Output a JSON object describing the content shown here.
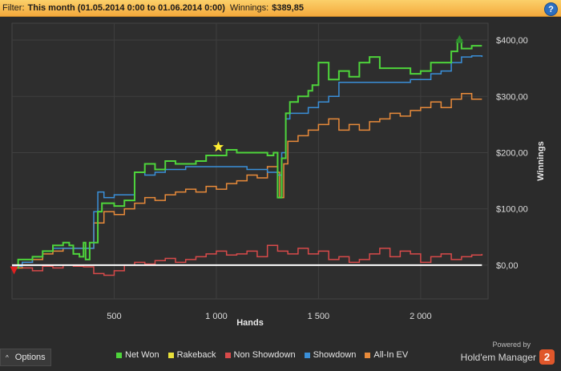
{
  "filter": {
    "label": "Filter:",
    "value": "This month (01.05.2014 0:00 to 01.06.2014 0:00)",
    "winnings_label": "Winnings:",
    "winnings_value": "$389,85",
    "help_label": "?"
  },
  "options": {
    "label": "Options",
    "caret": "^"
  },
  "branding": {
    "powered_by": "Powered by",
    "product": "Hold'em Manager",
    "logo_text": "2"
  },
  "legend": [
    {
      "name": "Net Won",
      "color": "#4ed43b"
    },
    {
      "name": "Rakeback",
      "color": "#e8e03a"
    },
    {
      "name": "Non Showdown",
      "color": "#d84a4a"
    },
    {
      "name": "Showdown",
      "color": "#3a8fd8"
    },
    {
      "name": "All-In EV",
      "color": "#e88a3a"
    }
  ],
  "chart_data": {
    "type": "line",
    "xlabel": "Hands",
    "ylabel": "Winnings",
    "x_ticks": [
      500,
      1000,
      1500,
      2000
    ],
    "x_tick_labels": [
      "500",
      "1 000",
      "1 500",
      "2 000"
    ],
    "y_ticks": [
      0,
      100,
      200,
      300,
      400
    ],
    "y_tick_labels": [
      "$0,00",
      "$100,00",
      "$200,00",
      "$300,00",
      "$400,00"
    ],
    "xlim": [
      0,
      2330
    ],
    "ylim": [
      -60,
      430
    ],
    "grid": true,
    "legend_position": "bottom",
    "series": [
      {
        "name": "Net Won",
        "color": "#4ed43b",
        "x": [
          0,
          30,
          100,
          150,
          200,
          250,
          280,
          300,
          330,
          350,
          360,
          380,
          420,
          440,
          500,
          550,
          600,
          650,
          700,
          750,
          800,
          850,
          900,
          950,
          1000,
          1050,
          1100,
          1150,
          1200,
          1250,
          1280,
          1300,
          1320,
          1340,
          1360,
          1400,
          1450,
          1470,
          1500,
          1550,
          1600,
          1650,
          1700,
          1750,
          1800,
          1850,
          1900,
          1950,
          2000,
          2050,
          2100,
          2150,
          2180,
          2200,
          2250,
          2300
        ],
        "y": [
          -5,
          10,
          15,
          25,
          35,
          40,
          35,
          20,
          15,
          40,
          10,
          40,
          95,
          110,
          105,
          115,
          165,
          180,
          170,
          185,
          180,
          180,
          185,
          195,
          195,
          205,
          200,
          200,
          200,
          195,
          200,
          120,
          190,
          270,
          290,
          300,
          310,
          320,
          360,
          330,
          345,
          335,
          360,
          370,
          350,
          350,
          350,
          340,
          345,
          360,
          360,
          380,
          400,
          385,
          390,
          390
        ]
      },
      {
        "name": "Showdown",
        "color": "#3a8fd8",
        "x": [
          0,
          50,
          100,
          150,
          200,
          250,
          300,
          350,
          400,
          420,
          450,
          500,
          550,
          600,
          650,
          700,
          750,
          800,
          850,
          900,
          950,
          1000,
          1050,
          1100,
          1150,
          1200,
          1250,
          1300,
          1320,
          1340,
          1360,
          1400,
          1450,
          1500,
          1550,
          1600,
          1650,
          1700,
          1750,
          1800,
          1850,
          1900,
          1950,
          2000,
          2050,
          2100,
          2150,
          2200,
          2250,
          2300
        ],
        "y": [
          -2,
          5,
          15,
          25,
          30,
          30,
          30,
          30,
          95,
          130,
          120,
          125,
          125,
          165,
          160,
          165,
          170,
          170,
          175,
          175,
          175,
          175,
          175,
          175,
          170,
          170,
          165,
          160,
          200,
          260,
          270,
          270,
          280,
          290,
          300,
          325,
          325,
          325,
          325,
          325,
          325,
          325,
          330,
          330,
          340,
          345,
          360,
          370,
          372,
          370
        ]
      },
      {
        "name": "All-In EV",
        "color": "#e88a3a",
        "x": [
          0,
          50,
          100,
          150,
          200,
          250,
          300,
          350,
          400,
          450,
          500,
          550,
          600,
          650,
          700,
          750,
          800,
          850,
          900,
          950,
          1000,
          1050,
          1100,
          1150,
          1200,
          1250,
          1300,
          1310,
          1330,
          1350,
          1400,
          1450,
          1500,
          1550,
          1600,
          1650,
          1700,
          1750,
          1800,
          1850,
          1900,
          1950,
          2000,
          2050,
          2100,
          2150,
          2200,
          2250,
          2300
        ],
        "y": [
          -5,
          5,
          10,
          20,
          25,
          30,
          30,
          30,
          75,
          95,
          90,
          100,
          110,
          120,
          115,
          125,
          130,
          135,
          130,
          140,
          135,
          145,
          150,
          160,
          155,
          175,
          165,
          120,
          180,
          220,
          230,
          240,
          250,
          260,
          240,
          250,
          240,
          255,
          260,
          270,
          265,
          275,
          280,
          290,
          280,
          295,
          305,
          295,
          295
        ]
      },
      {
        "name": "Non Showdown",
        "color": "#d84a4a",
        "x": [
          0,
          50,
          100,
          150,
          200,
          250,
          300,
          350,
          400,
          450,
          500,
          550,
          600,
          650,
          700,
          750,
          800,
          850,
          900,
          950,
          1000,
          1050,
          1100,
          1150,
          1200,
          1250,
          1300,
          1350,
          1400,
          1450,
          1500,
          1550,
          1600,
          1650,
          1700,
          1750,
          1800,
          1850,
          1900,
          1950,
          2000,
          2050,
          2100,
          2150,
          2200,
          2250,
          2300
        ],
        "y": [
          -5,
          -5,
          -10,
          -2,
          -5,
          0,
          -2,
          -3,
          -15,
          -18,
          -10,
          0,
          5,
          2,
          8,
          12,
          5,
          10,
          15,
          20,
          25,
          18,
          20,
          25,
          15,
          35,
          25,
          20,
          30,
          20,
          25,
          10,
          15,
          5,
          10,
          20,
          30,
          15,
          25,
          20,
          5,
          15,
          20,
          10,
          15,
          18,
          20
        ]
      },
      {
        "name": "Rakeback",
        "color": "#e8e03a",
        "x": [
          0,
          2300
        ],
        "y": [
          0,
          0
        ]
      }
    ],
    "markers": [
      {
        "type": "star",
        "x": 1010,
        "y": 210,
        "color": "#ffee33"
      },
      {
        "type": "triangle-up",
        "x": 2190,
        "y": 402,
        "color": "#2e8b2e"
      },
      {
        "type": "triangle-down",
        "x": 10,
        "y": -8,
        "color": "#e02020"
      }
    ]
  }
}
